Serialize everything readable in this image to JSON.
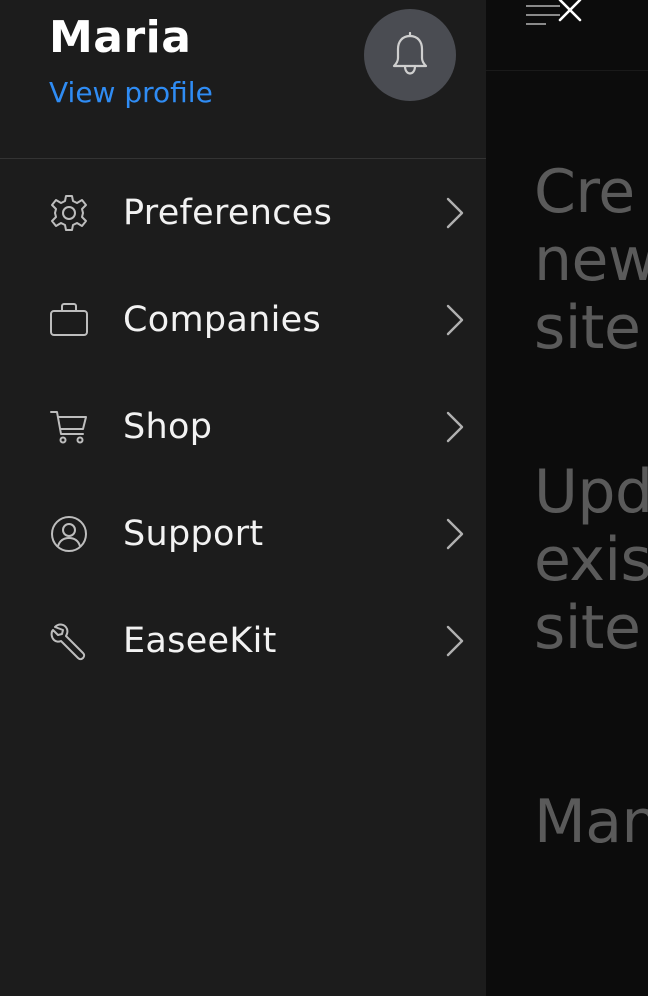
{
  "profile": {
    "name": "Maria",
    "view_profile_label": "View profile"
  },
  "menu": {
    "items": [
      {
        "label": "Preferences",
        "icon": "gear-icon"
      },
      {
        "label": "Companies",
        "icon": "briefcase-icon"
      },
      {
        "label": "Shop",
        "icon": "cart-icon"
      },
      {
        "label": "Support",
        "icon": "support-agent-icon"
      },
      {
        "label": "EaseeKit",
        "icon": "wrench-icon"
      }
    ]
  },
  "background": {
    "headings": [
      "Cre\nnew\nsite",
      "Upd\nexis\nsite",
      "Man"
    ]
  },
  "colors": {
    "drawer_bg": "#1c1c1c",
    "link": "#2f8cf4",
    "bell_bg": "#4a4c52",
    "background_text": "#5a5a5a"
  }
}
